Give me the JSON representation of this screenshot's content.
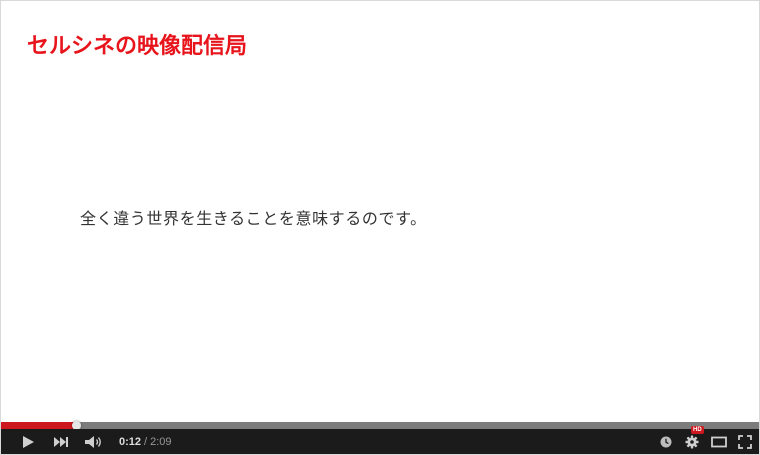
{
  "video": {
    "channel_title": "セルシネの映像配信局",
    "subtitle": "全く違う世界を生きることを意味するのです。"
  },
  "player": {
    "progress_fraction": 0.097,
    "loaded_fraction": 0.105,
    "current_time": "0:12",
    "time_separator": "/",
    "duration": "2:09",
    "hd_badge": "HD",
    "colors": {
      "played": "#cc181e",
      "title": "#e8141c",
      "controls_bg": "#1b1b1b"
    },
    "icons": [
      "play-icon",
      "next-icon",
      "volume-icon",
      "watch-later-icon",
      "settings-icon",
      "theater-mode-icon",
      "fullscreen-icon"
    ]
  }
}
